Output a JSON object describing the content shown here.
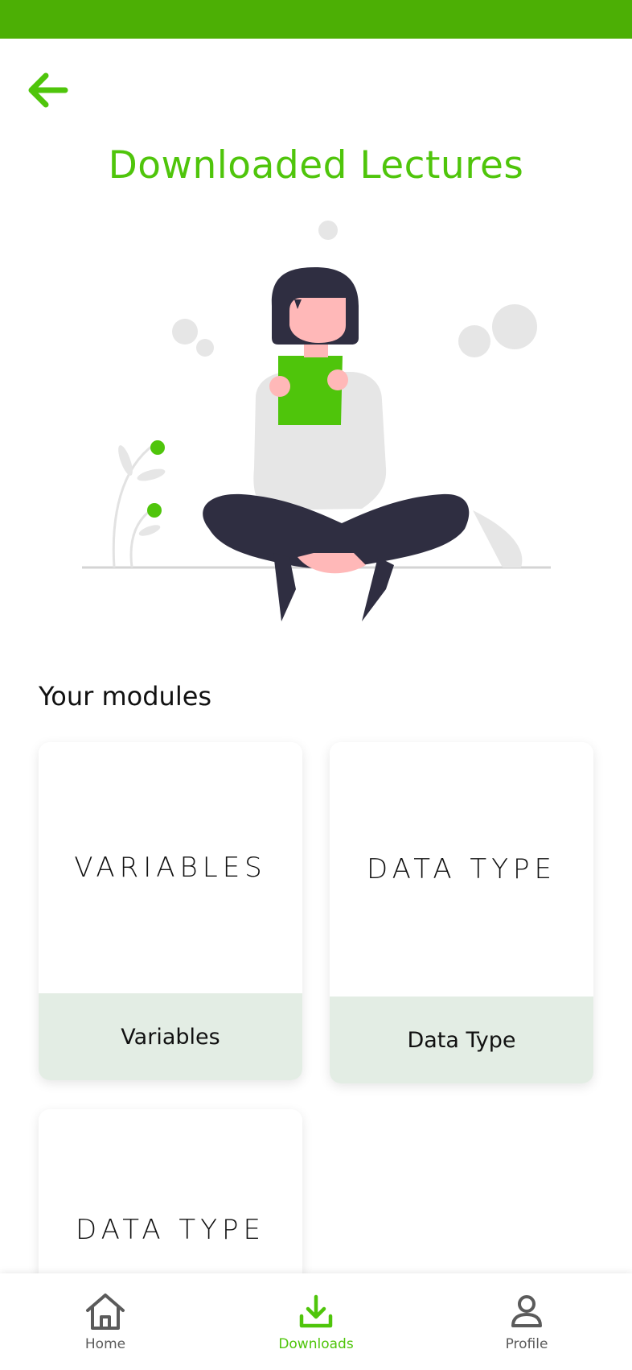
{
  "header": {
    "title": "Downloaded Lectures"
  },
  "section": {
    "heading": "Your modules"
  },
  "modules": [
    {
      "thumb": "VARIABLES",
      "label": "Variables"
    },
    {
      "thumb": "DATA TYPE",
      "label": "Data Type"
    },
    {
      "thumb": "DATA TYPE",
      "label": ""
    }
  ],
  "nav": {
    "items": [
      {
        "label": "Home",
        "icon": "home-icon"
      },
      {
        "label": "Downloads",
        "icon": "download-icon",
        "active": true
      },
      {
        "label": "Profile",
        "icon": "profile-icon"
      }
    ]
  },
  "colors": {
    "status_bar": "#4caf05",
    "accent": "#4fc50b",
    "card_footer": "#e3ede4",
    "nav_inactive": "#5b5b5b"
  }
}
